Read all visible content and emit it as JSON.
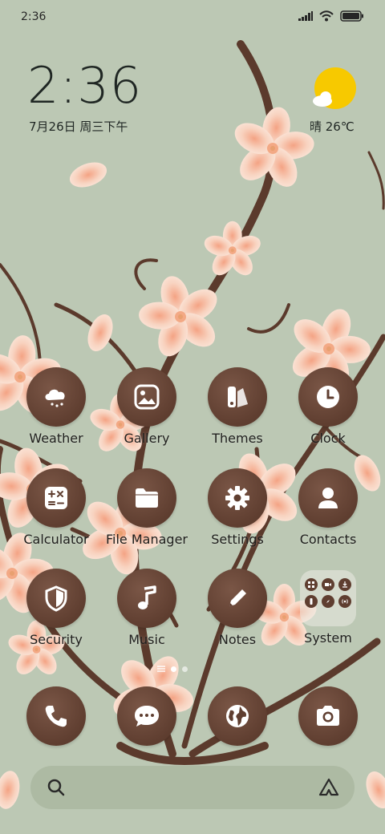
{
  "status_bar": {
    "time": "2:36"
  },
  "lockclock": {
    "time": "2:36",
    "date": "7月26日 周三下午"
  },
  "weather": {
    "text": "晴 26℃"
  },
  "apps": [
    {
      "label": "Weather",
      "icon": "weather-icon"
    },
    {
      "label": "Gallery",
      "icon": "gallery-icon"
    },
    {
      "label": "Themes",
      "icon": "themes-icon"
    },
    {
      "label": "Clock",
      "icon": "clock-icon"
    },
    {
      "label": "Calculator",
      "icon": "calculator-icon"
    },
    {
      "label": "File Manager",
      "icon": "folder-icon"
    },
    {
      "label": "Settings",
      "icon": "gear-icon"
    },
    {
      "label": "Contacts",
      "icon": "person-icon"
    },
    {
      "label": "Security",
      "icon": "shield-icon"
    },
    {
      "label": "Music",
      "icon": "music-note-icon"
    },
    {
      "label": "Notes",
      "icon": "pencil-icon"
    },
    {
      "label": "System",
      "icon": "folder-grid-icon"
    }
  ],
  "dock": [
    {
      "name": "phone",
      "icon": "phone-icon"
    },
    {
      "name": "messages",
      "icon": "message-icon"
    },
    {
      "name": "browser",
      "icon": "globe-icon"
    },
    {
      "name": "camera",
      "icon": "camera-icon"
    }
  ],
  "search": {
    "placeholder": ""
  },
  "colors": {
    "background": "#bcc8b4",
    "icon_fill": "#5f3e30",
    "petal": "#f6c9b4",
    "branch": "#5b3a2c",
    "sun": "#f7c900"
  }
}
